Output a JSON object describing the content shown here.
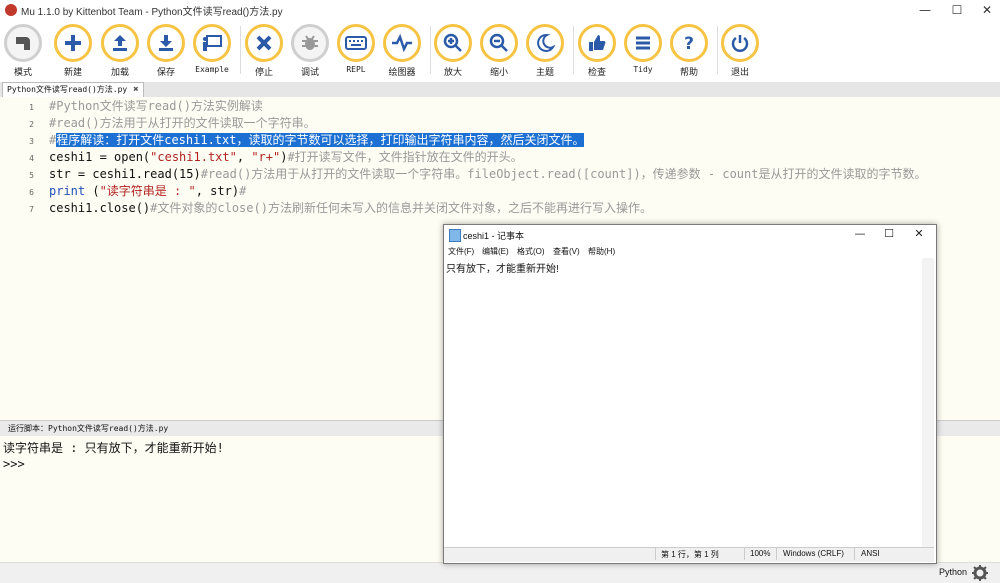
{
  "window": {
    "title": "Mu 1.1.0 by Kittenbot Team - Python文件读写read()方法.py",
    "minimize": "—",
    "maximize": "☐",
    "close": "✕"
  },
  "toolbar": {
    "mode": "模式",
    "new": "新建",
    "load": "加载",
    "save": "保存",
    "example": "Example",
    "stop": "停止",
    "debug": "调试",
    "repl": "REPL",
    "plotter": "绘图器",
    "zoom_in": "放大",
    "zoom_out": "缩小",
    "theme": "主题",
    "check": "检查",
    "tidy": "Tidy",
    "help": "帮助",
    "quit": "退出"
  },
  "tab": {
    "label": "Python文件读写read()方法.py",
    "close": "✖"
  },
  "editor": {
    "line_numbers": [
      "1",
      "2",
      "3",
      "4",
      "5",
      "6",
      "7"
    ],
    "l1": "#Python文件读写read()方法实例解读",
    "l2": "#read()方法用于从打开的文件读取一个字符串。",
    "l3_hash": "#",
    "l3_hl": "程序解读：打开文件ceshi1.txt，读取的字节数可以选择，打印输出字符串内容，然后关闭文件。",
    "l4_a": "ceshi1 = open(",
    "l4_s1": "\"ceshi1.txt\"",
    "l4_b": ", ",
    "l4_s2": "\"r+\"",
    "l4_c": ")",
    "l4_cmt": "#打开读写文件，文件指针放在文件的开头。",
    "l5_a": "str = ceshi1.read(15)",
    "l5_cmt": "#read()方法用于从打开的文件读取一个字符串。fileObject.read([count])，传递参数 - count是从打开的文件读取的字节数。",
    "l6_kw": "print",
    "l6_a": " (",
    "l6_s": "\"读字符串是 : \"",
    "l6_b": ", str)",
    "l6_cmt": "#",
    "l7_a": "ceshi1.close()",
    "l7_cmt": "#文件对象的close()方法刷新任何未写入的信息并关闭文件对象，之后不能再进行写入操作。"
  },
  "runbar": {
    "label": "运行脚本：Python文件读写read()方法.py"
  },
  "output": {
    "line1": "读字符串是 :  只有放下，才能重新开始!",
    "line2": ">>>"
  },
  "statusbar": {
    "mode": "Python"
  },
  "notepad": {
    "title": "ceshi1 - 记事本",
    "menu": [
      "文件(F)",
      "编辑(E)",
      "格式(O)",
      "查看(V)",
      "帮助(H)"
    ],
    "content": "只有放下，才能重新开始!",
    "status_pos": "第 1 行，第 1 列",
    "status_zoom": "100%",
    "status_eol": "Windows (CRLF)",
    "status_enc": "ANSI"
  }
}
